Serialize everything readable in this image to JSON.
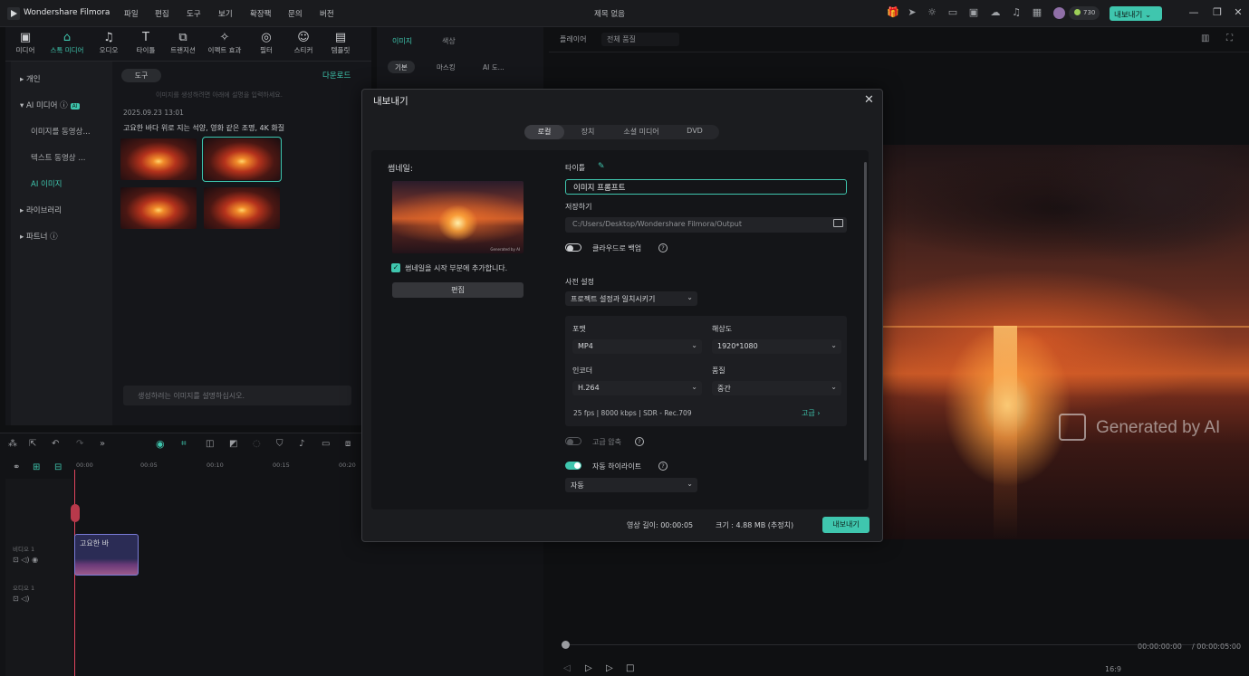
{
  "app": {
    "name": "Wondershare Filmora",
    "menu": [
      "파일",
      "편집",
      "도구",
      "보기",
      "확장팩",
      "문의",
      "버전"
    ],
    "project_title": "제목 없음",
    "credits": "730",
    "export_button": "내보내기 ⌄",
    "window_controls": [
      "—",
      "❐",
      "✕"
    ]
  },
  "nav_tabs": [
    {
      "label": "미디어",
      "icon": "media-icon"
    },
    {
      "label": "스톡 미디어",
      "icon": "stock-media-icon"
    },
    {
      "label": "오디오",
      "icon": "audio-icon"
    },
    {
      "label": "타이틀",
      "icon": "title-icon"
    },
    {
      "label": "트랜지션",
      "icon": "transition-icon"
    },
    {
      "label": "이펙트 효과",
      "icon": "effects-icon"
    },
    {
      "label": "필터",
      "icon": "filter-icon"
    },
    {
      "label": "스티커",
      "icon": "sticker-icon"
    },
    {
      "label": "템플릿",
      "icon": "template-icon"
    }
  ],
  "sidebar": {
    "items": [
      {
        "label": "▸  개인"
      },
      {
        "label": "▾  AI 미디어 ⓘ",
        "badge": "AI"
      },
      {
        "label": "이미지를 동영상..."
      },
      {
        "label": "텍스트 동영상 ..."
      },
      {
        "label": "AI 이미지"
      },
      {
        "label": "▸  라이브러리"
      },
      {
        "label": "▸  파트너 ⓘ"
      }
    ]
  },
  "stock": {
    "tool_button": "도구",
    "download_link": "다운로드",
    "hint": "이미지를 생성하려면 아래에 설명을 입력하세요.",
    "date": "2025.09.23  13:01",
    "prompt_caption": "고요한 바다 위로 지는 석양, 영화 같은 조명, 4K 화질",
    "input_placeholder": "생성하려는 이미지를 설명하십시오."
  },
  "media_panel": {
    "tabs": [
      "이미지",
      "색상"
    ],
    "chips": [
      "기본",
      "마스킹",
      "AI 도..."
    ]
  },
  "player": {
    "label": "플레이어",
    "quality": "전체 품질",
    "watermark": "Generated by AI",
    "timecode_current": "00:00:00:00",
    "timecode_total": "/  00:00:05:00",
    "aspect": "16:9"
  },
  "timeline": {
    "ruler": [
      "00:00",
      "00:05",
      "00:10",
      "00:15",
      "00:20"
    ],
    "clip_label": "고요한 바",
    "video_track": "비디오 1",
    "audio_track": "오디오 1"
  },
  "dialog": {
    "title": "내보내기",
    "close": "✕",
    "tabs": [
      "로컬",
      "장치",
      "소셜 미디어",
      "DVD"
    ],
    "thumbnail_label": "썸네일:",
    "thumbnail_watermark": "Generated by AI",
    "thumbnail_checkbox": "썸네일을 시작 부분에 추가합니다.",
    "edit_button": "편집",
    "title_label": "타이틀",
    "title_value": "이미지 프롬프트",
    "save_label": "저장하기",
    "save_path": "C:/Users/Desktop/Wondershare Filmora/Output",
    "cloud_backup": "클라우드로 백업",
    "preset_label": "사전 설정",
    "preset_value": "프로젝트 설정과 일치시키기",
    "format_label": "포맷",
    "format_value": "MP4",
    "resolution_label": "해상도",
    "resolution_value": "1920*1080",
    "encoder_label": "인코더",
    "encoder_value": "H.264",
    "quality_label": "품질",
    "quality_value": "중간",
    "specs": "25 fps   |   8000 kbps   |   SDR - Rec.709",
    "advanced": "고급  ›",
    "advanced_compress": "고급 압축",
    "auto_highlight": "자동 하이라이트",
    "auto_value": "자동",
    "duration": "영상 길이: 00:00:05",
    "size": "크기 :  4.88 MB (추정치)",
    "export_button": "내보내기"
  },
  "colors": {
    "accent": "#3fc6ae",
    "background": "#0f1012",
    "panel": "#15161a",
    "dialog": "#1b1c1f"
  }
}
